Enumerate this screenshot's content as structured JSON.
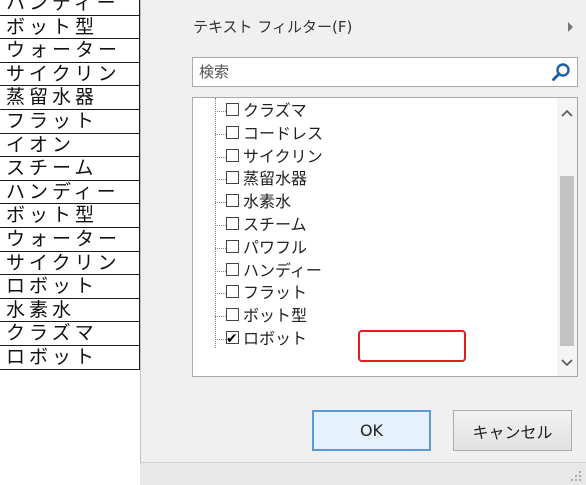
{
  "sheet": {
    "rows": [
      "ハンディー",
      "ボット型",
      "ウォーター",
      "サイクリン",
      "蒸留水器",
      "フラット",
      "イオン",
      "スチーム",
      "ハンディー",
      "ボット型",
      "ウォーター",
      "サイクリン",
      "ロボット",
      "水素水",
      "クラズマ",
      "ロボット"
    ]
  },
  "filter_panel": {
    "text_filter_label": "テキスト フィルター(F)",
    "search_placeholder": "検索",
    "items": [
      {
        "label": "クラズマ",
        "checked": false
      },
      {
        "label": "コードレス",
        "checked": false
      },
      {
        "label": "サイクリン",
        "checked": false
      },
      {
        "label": "蒸留水器",
        "checked": false
      },
      {
        "label": "水素水",
        "checked": false
      },
      {
        "label": "スチーム",
        "checked": false
      },
      {
        "label": "パワフル",
        "checked": false
      },
      {
        "label": "ハンディー",
        "checked": false
      },
      {
        "label": "フラット",
        "checked": false
      },
      {
        "label": "ボット型",
        "checked": false
      },
      {
        "label": "ロボット",
        "checked": true
      }
    ],
    "ok_label": "OK",
    "cancel_label": "キャンセル"
  },
  "icons": {
    "search": "search-icon",
    "submenu": "chevron-right-icon",
    "scroll_up": "chevron-up-icon",
    "scroll_down": "chevron-down-icon",
    "resize": "resize-grip-icon",
    "checkmark": "checkmark-icon"
  },
  "colors": {
    "highlight": "#e51b24",
    "ok_border": "#5b9bd5",
    "panel_bg": "#f0f0f0"
  }
}
